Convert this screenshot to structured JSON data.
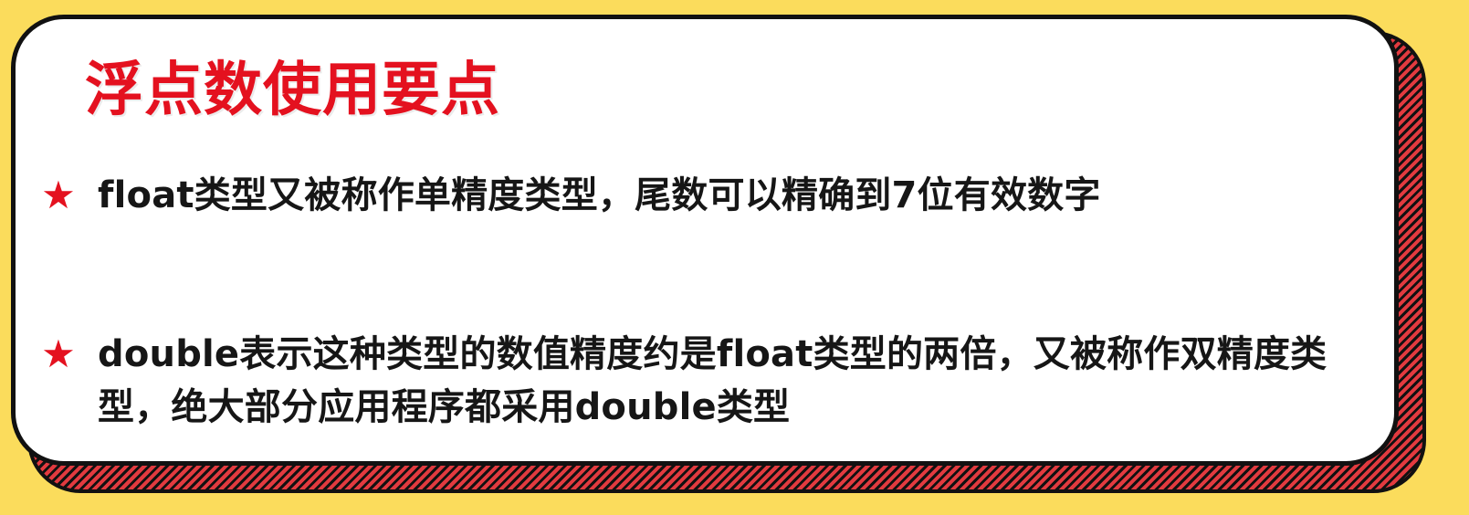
{
  "slide": {
    "title": "浮点数使用要点",
    "bullets": [
      {
        "marker": "★",
        "text": "float类型又被称作单精度类型，尾数可以精确到7位有效数字"
      },
      {
        "marker": "★",
        "text": "double表示这种类型的数值精度约是float类型的两倍，又被称作双精度类型，绝大部分应用程序都采用double类型"
      }
    ]
  },
  "colors": {
    "background": "#fbdc5c",
    "accent_red": "#e4111f",
    "border": "#111111",
    "card": "#ffffff",
    "text": "#161616"
  }
}
